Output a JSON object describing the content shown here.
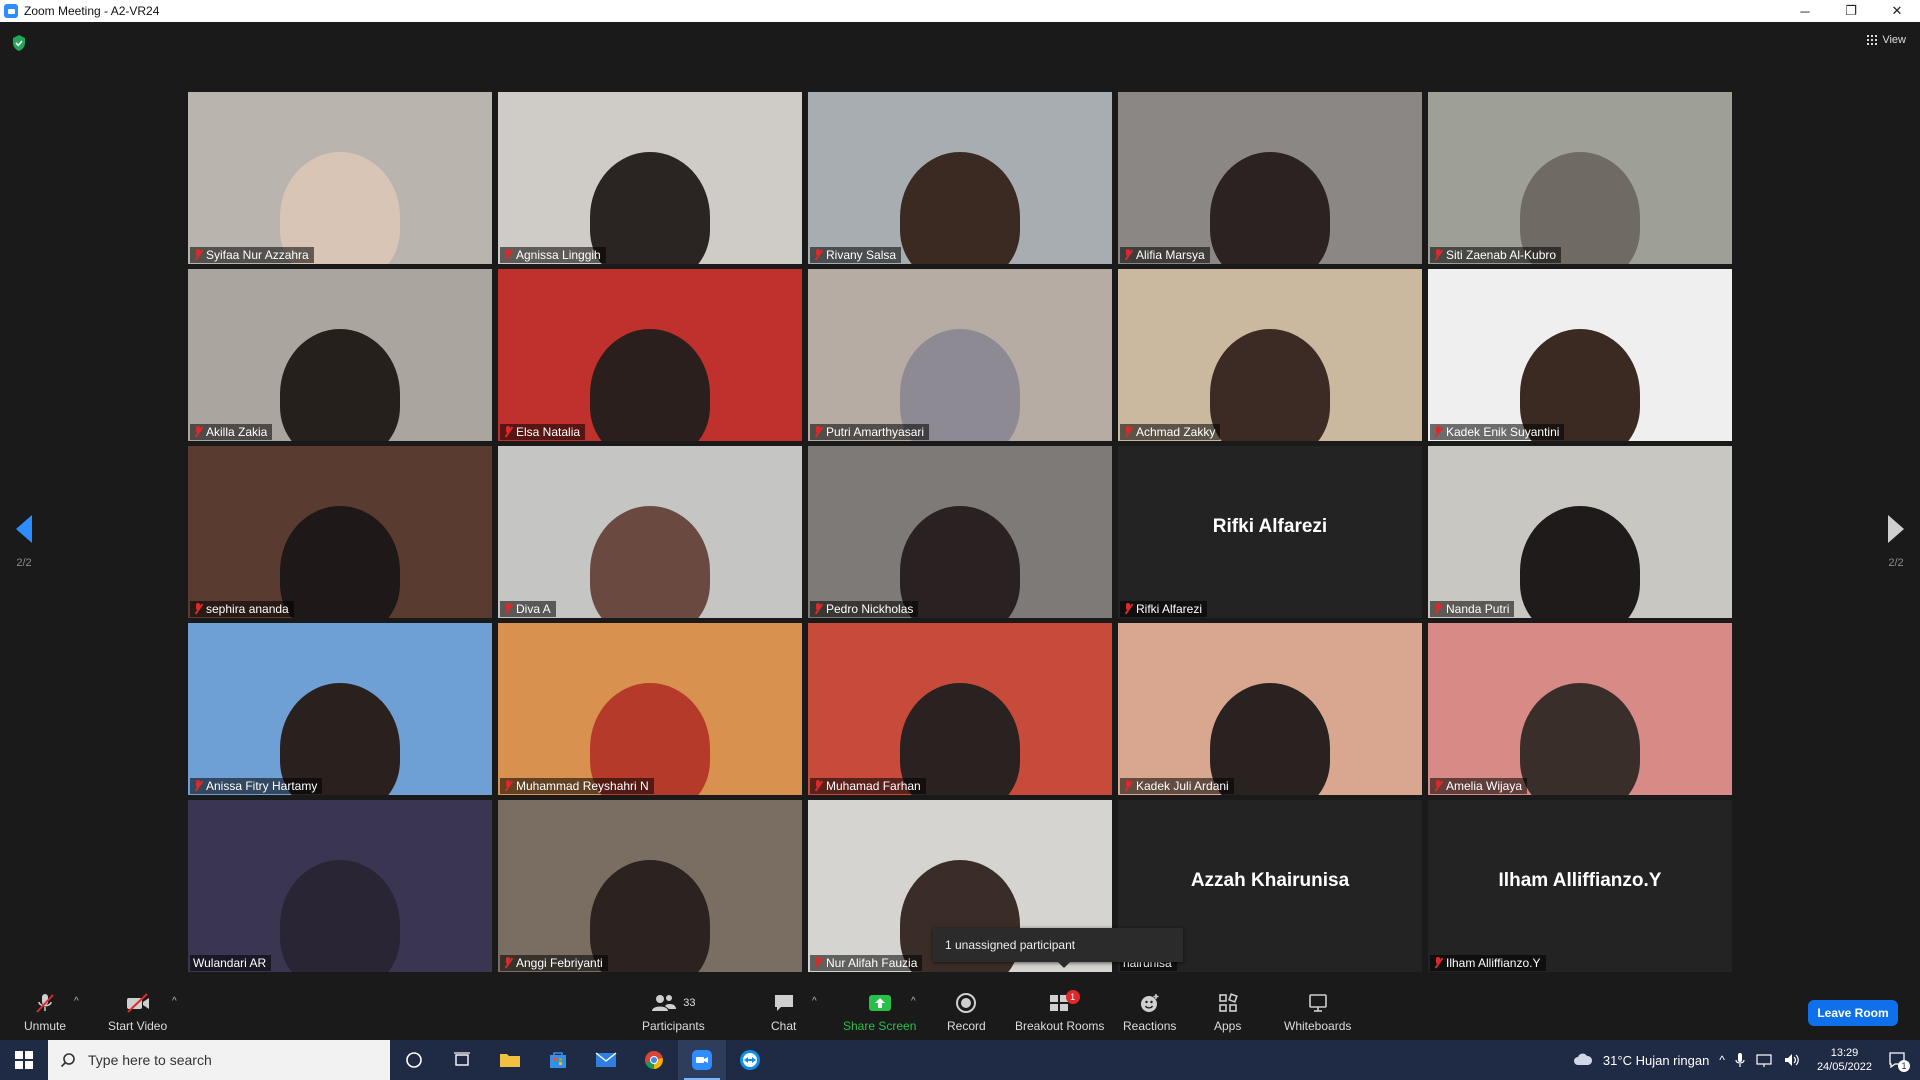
{
  "window": {
    "title": "Zoom Meeting - A2-VR24",
    "minimize": "─",
    "restore": "❐",
    "close": "✕"
  },
  "meeting": {
    "view_label": "View",
    "page_left": "2/2",
    "page_right": "2/2",
    "tooltip": "1 unassigned participant",
    "tiles": [
      {
        "name": "Syifaa Nur Azzahra",
        "bg": "#b9b4ae",
        "skin": "#d8c5b5"
      },
      {
        "name": "Agnissa Linggih",
        "bg": "#cfccc8",
        "skin": "#2a2422"
      },
      {
        "name": "Rivany Salsa",
        "bg": "#a7adb1",
        "skin": "#3a2a22"
      },
      {
        "name": "Alifia Marsya",
        "bg": "#8a8784",
        "skin": "#2b2221"
      },
      {
        "name": "Siti Zaenab Al-Kubro",
        "bg": "#9ea096",
        "skin": "#6f6a64"
      },
      {
        "name": "Akilla Zakia",
        "bg": "#aaa59f",
        "skin": "#26201d"
      },
      {
        "name": "Elsa Natalia",
        "bg": "#c0302c",
        "skin": "#2a1f1c"
      },
      {
        "name": "Putri Amarthyasari",
        "bg": "#b6aca3",
        "skin": "#8d8a93"
      },
      {
        "name": "Achmad Zakky",
        "bg": "#cbb99f",
        "skin": "#3b2b24"
      },
      {
        "name": "Kadek Enik Suyantini",
        "bg": "#efefef",
        "skin": "#3a2a22"
      },
      {
        "name": "sephira ananda",
        "bg": "#5a3b2f",
        "skin": "#1e1818"
      },
      {
        "name": "Diva A",
        "bg": "#c5c5c3",
        "skin": "#6a4a40"
      },
      {
        "name": "Pedro Nickholas",
        "bg": "#7d7a77",
        "skin": "#2a2222"
      },
      {
        "name": "Rifki Alfarezi",
        "bg": "#232323",
        "skin": "",
        "big": "Rifki Alfarezi"
      },
      {
        "name": "Nanda Putri",
        "bg": "#c9c7c2",
        "skin": "#1f1b1b"
      },
      {
        "name": "Anissa Fitry Hartamy",
        "bg": "#6ea0d6",
        "skin": "#2a211f"
      },
      {
        "name": "Muhammad Reyshahri N",
        "bg": "#d9914f",
        "skin": "#b53a2a"
      },
      {
        "name": "Muhamad Farhan",
        "bg": "#c84a3a",
        "skin": "#2a2220"
      },
      {
        "name": "Kadek Juli Ardani",
        "bg": "#d9a78f",
        "skin": "#2a2220"
      },
      {
        "name": "Amelia Wijaya",
        "bg": "#d88a86",
        "skin": "#3a2e2b"
      },
      {
        "name": "Wulandari AR",
        "bg": "#3a3550",
        "skin": "#2a2535",
        "nomute": true
      },
      {
        "name": "Anggi Febriyanti",
        "bg": "#7a6e62",
        "skin": "#2a2320"
      },
      {
        "name": "Nur Alifah Fauzia",
        "bg": "#d6d4d0",
        "skin": "#3a2d28"
      },
      {
        "name": "hairunisa",
        "bg": "#232323",
        "skin": "",
        "big": "Azzah Khairunisa",
        "nomute": true
      },
      {
        "name": "Ilham Alliffianzo.Y",
        "bg": "#232323",
        "skin": "",
        "big": "Ilham Alliffianzo.Y"
      }
    ]
  },
  "toolbar": {
    "unmute": "Unmute",
    "start_video": "Start Video",
    "participants": "Participants",
    "participants_count": "33",
    "chat": "Chat",
    "share_screen": "Share Screen",
    "record": "Record",
    "breakout_rooms": "Breakout Rooms",
    "breakout_badge": "1",
    "reactions": "Reactions",
    "apps": "Apps",
    "whiteboards": "Whiteboards",
    "leave": "Leave Room"
  },
  "taskbar": {
    "search_placeholder": "Type here to search",
    "weather": "31°C  Hujan ringan",
    "time": "13:29",
    "date": "24/05/2022",
    "notification_count": "1"
  },
  "colors": {
    "accent": "#2d8cff",
    "leave": "#0e71eb",
    "share": "#27c04a",
    "muted": "#e02828"
  }
}
